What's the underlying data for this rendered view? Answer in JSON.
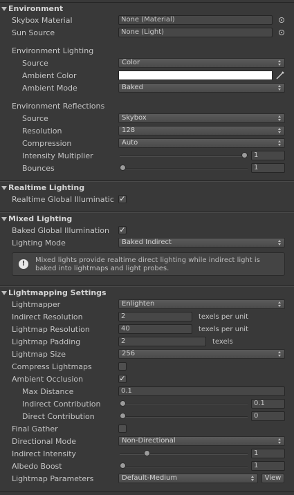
{
  "environment": {
    "header": "Environment",
    "skybox_material": {
      "label": "Skybox Material",
      "value": "None (Material)"
    },
    "sun_source": {
      "label": "Sun Source",
      "value": "None (Light)"
    },
    "lighting_title": "Environment Lighting",
    "source": {
      "label": "Source",
      "value": "Color"
    },
    "ambient_color": {
      "label": "Ambient Color",
      "color": "#ffffff"
    },
    "ambient_mode": {
      "label": "Ambient Mode",
      "value": "Baked"
    },
    "reflections_title": "Environment Reflections",
    "refl_source": {
      "label": "Source",
      "value": "Skybox"
    },
    "resolution": {
      "label": "Resolution",
      "value": "128"
    },
    "compression": {
      "label": "Compression",
      "value": "Auto"
    },
    "intensity_multiplier": {
      "label": "Intensity Multiplier",
      "value": "1",
      "fraction": 1.0
    },
    "bounces": {
      "label": "Bounces",
      "value": "1",
      "fraction": 0.0
    }
  },
  "realtime": {
    "header": "Realtime Lighting",
    "gi": {
      "label": "Realtime Global Illuminatic",
      "checked": true
    }
  },
  "mixed": {
    "header": "Mixed Lighting",
    "baked_gi": {
      "label": "Baked Global Illumination",
      "checked": true
    },
    "lighting_mode": {
      "label": "Lighting Mode",
      "value": "Baked Indirect"
    },
    "help": "Mixed lights provide realtime direct lighting while indirect light is baked into lightmaps and light probes."
  },
  "lightmapping": {
    "header": "Lightmapping Settings",
    "lightmapper": {
      "label": "Lightmapper",
      "value": "Enlighten"
    },
    "indirect_resolution": {
      "label": "Indirect Resolution",
      "value": "2",
      "unit": "texels per unit"
    },
    "lightmap_resolution": {
      "label": "Lightmap Resolution",
      "value": "40",
      "unit": "texels per unit"
    },
    "lightmap_padding": {
      "label": "Lightmap Padding",
      "value": "2",
      "unit": "texels"
    },
    "lightmap_size": {
      "label": "Lightmap Size",
      "value": "256"
    },
    "compress": {
      "label": "Compress Lightmaps",
      "checked": false
    },
    "ambient_occlusion": {
      "label": "Ambient Occlusion",
      "checked": true
    },
    "max_distance": {
      "label": "Max Distance",
      "value": "0.1"
    },
    "indirect_contribution": {
      "label": "Indirect Contribution",
      "value": "0.1",
      "fraction": 0.0
    },
    "direct_contribution": {
      "label": "Direct Contribution",
      "value": "0",
      "fraction": 0.0
    },
    "final_gather": {
      "label": "Final Gather",
      "checked": false
    },
    "directional_mode": {
      "label": "Directional Mode",
      "value": "Non-Directional"
    },
    "indirect_intensity": {
      "label": "Indirect Intensity",
      "value": "1",
      "fraction": 0.2
    },
    "albedo_boost": {
      "label": "Albedo Boost",
      "value": "1",
      "fraction": 0.0
    },
    "params": {
      "label": "Lightmap Parameters",
      "value": "Default-Medium",
      "view": "View"
    }
  }
}
